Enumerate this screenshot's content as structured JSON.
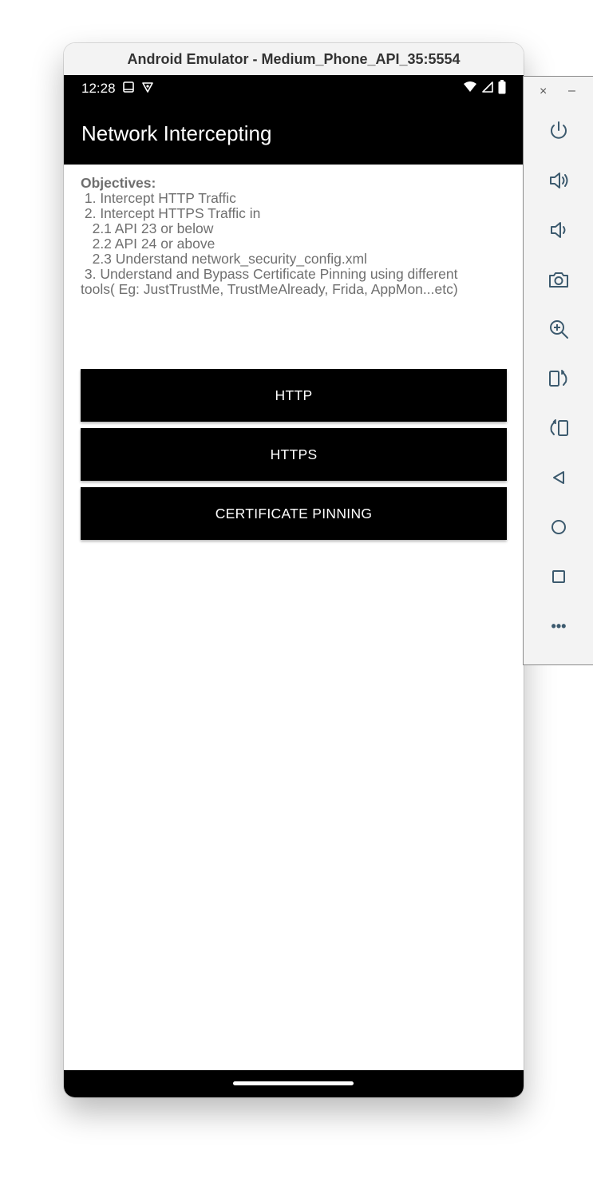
{
  "window": {
    "title": "Android Emulator - Medium_Phone_API_35:5554"
  },
  "status_bar": {
    "time": "12:28"
  },
  "app_bar": {
    "title": "Network Intercepting"
  },
  "objectives": {
    "heading": "Objectives:",
    "lines": [
      " 1. Intercept HTTP Traffic",
      " 2. Intercept HTTPS Traffic in",
      "   2.1 API 23 or below",
      "   2.2 API 24 or above",
      "   2.3 Understand network_security_config.xml",
      " 3. Understand and Bypass Certificate Pinning using different",
      "tools( Eg: JustTrustMe, TrustMeAlready, Frida, AppMon...etc)"
    ]
  },
  "buttons": {
    "http": "HTTP",
    "https": "HTTPS",
    "pinning": "CERTIFICATE PINNING"
  },
  "toolbar": {
    "close": "×",
    "minimize": "–",
    "more": "•••"
  },
  "colors": {
    "app_bar": "#000000",
    "button": "#000000",
    "text_secondary": "#6f6f6f",
    "toolbar_bg": "#f3f3f3",
    "icon": "#3c5a6e"
  }
}
